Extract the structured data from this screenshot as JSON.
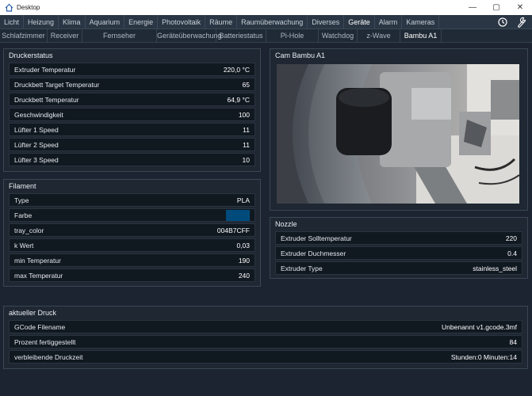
{
  "window": {
    "title": "Desktop",
    "minimize": "—",
    "maximize": "▢",
    "close": "✕"
  },
  "nav_main": {
    "tabs": [
      "Licht",
      "Heizung",
      "Klima",
      "Aquarium",
      "Energie",
      "Photovoltaik",
      "Räume",
      "Raumüberwachung",
      "Diverses",
      "Geräte",
      "Alarm",
      "Kameras"
    ],
    "active": "Geräte"
  },
  "nav_sub": {
    "tabs": [
      "Schlafzimmer",
      "Receiver",
      "Fernseher",
      "Geräteüberwachung",
      "Batteriestatus",
      "Pi-Hole",
      "Watchdog",
      "z-Wave",
      "Bambu A1"
    ],
    "active": "Bambu A1"
  },
  "drucker": {
    "title": "Druckerstatus",
    "rows": [
      {
        "label": "Extruder Temperatur",
        "value": "220,0 °C"
      },
      {
        "label": "Druckbett Target Temperatur",
        "value": "65"
      },
      {
        "label": "Druckbett Temperatur",
        "value": "64,9 °C"
      },
      {
        "label": "Geschwindigkeit",
        "value": "100"
      },
      {
        "label": "Lüfter 1 Speed",
        "value": "11"
      },
      {
        "label": "Lüfter 2 Speed",
        "value": "11"
      },
      {
        "label": "Lüfter 3 Speed",
        "value": "10"
      }
    ]
  },
  "filament": {
    "title": "Filament",
    "type_label": "Type",
    "type_value": "PLA",
    "farbe_label": "Farbe",
    "farbe_color": "#004B7C",
    "rows": [
      {
        "label": "tray_color",
        "value": "004B7CFF"
      },
      {
        "label": "k Wert",
        "value": "0,03"
      },
      {
        "label": "min Temperatur",
        "value": "190"
      },
      {
        "label": "max Temperatur",
        "value": "240"
      }
    ]
  },
  "cam": {
    "title": "Cam Bambu A1"
  },
  "nozzle": {
    "title": "Nozzle",
    "rows": [
      {
        "label": "Extruder Solltemperatur",
        "value": "220"
      },
      {
        "label": "Extruder Duchmesser",
        "value": "0.4"
      },
      {
        "label": "Extruder Type",
        "value": "stainless_steel"
      }
    ]
  },
  "druck": {
    "title": "aktueller Druck",
    "rows": [
      {
        "label": "GCode Filename",
        "value": "Unbenannt v1.gcode.3mf"
      },
      {
        "label": "Prozent fertiggestellt",
        "value": "84"
      },
      {
        "label": "verbleibende Druckzeit",
        "value": "Stunden:0 Minuten:14"
      }
    ]
  }
}
